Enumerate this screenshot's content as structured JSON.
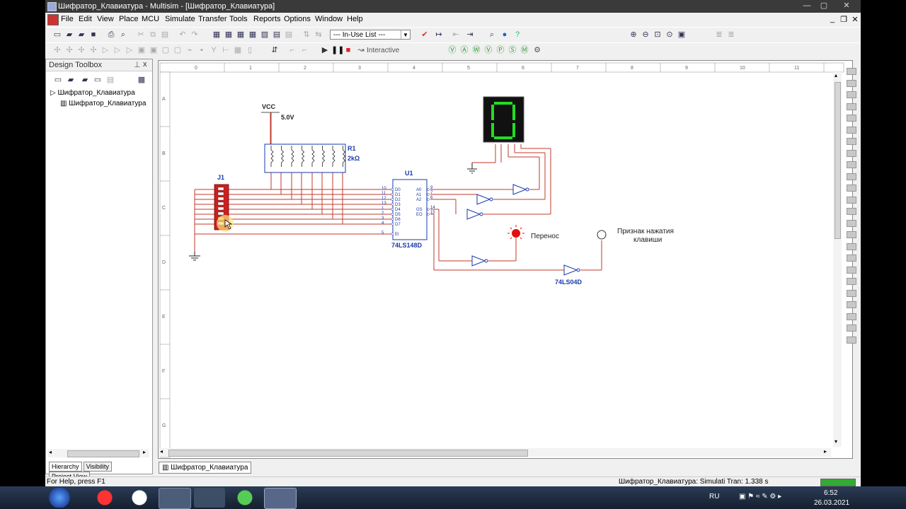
{
  "window": {
    "title": "Шифратор_Клавиатура - Multisim - [Шифратор_Клавиатура]",
    "controls": [
      "—",
      "▢",
      "✕"
    ],
    "mdi_controls": [
      "_",
      "❐",
      "✕"
    ]
  },
  "menu": [
    "File",
    "Edit",
    "View",
    "Place",
    "MCU",
    "Simulate",
    "Transfer",
    "Tools",
    "Reports",
    "Options",
    "Window",
    "Help"
  ],
  "toolbar": {
    "in_use_list": "--- In-Use List ---",
    "interactive": "Interactive"
  },
  "design_toolbox": {
    "title": "Design Toolbox",
    "close": "x",
    "tree": [
      "Шифратор_Клавиатура",
      "Шифратор_Клавиатура"
    ],
    "tabs": [
      "Hierarchy",
      "Visibility",
      "Project View"
    ]
  },
  "canvas": {
    "col_labels": [
      "0",
      "1",
      "2",
      "3",
      "4",
      "5",
      "6",
      "7",
      "8",
      "9",
      "10",
      "11"
    ],
    "row_labels": [
      "A",
      "B",
      "C",
      "D",
      "E",
      "F",
      "G"
    ],
    "vcc_label": "VCC",
    "vcc_value": "5.0V",
    "r1_label": "R1",
    "r1_value": "2kΩ",
    "j1_label": "J1",
    "u1_label": "U1",
    "u1_part": "74LS148D",
    "u1_pins_left": [
      "D0",
      "D1",
      "D2",
      "D3",
      "D4",
      "D5",
      "D6",
      "D7",
      "EI"
    ],
    "u1_pins_right": [
      "A0",
      "A1",
      "A2",
      "GS",
      "EO"
    ],
    "u1_pin_nums_left": [
      "10",
      "11",
      "12",
      "13",
      "1",
      "2",
      "3",
      "4",
      "5"
    ],
    "u1_pin_nums_right": [
      "9",
      "7",
      "6",
      "14",
      "15"
    ],
    "display_digit": "0",
    "led_label": "Перенос",
    "probe_label_line1": "Признак нажатия",
    "probe_label_line2": "клавиши",
    "inverter_part": "74LS04D"
  },
  "document_tab": "Шифратор_Клавиатура",
  "status": {
    "help": "For Help, press F1",
    "sim": "Шифратор_Клавиатура: Simulati Tran: 1.338 s"
  },
  "taskbar": {
    "lang": "RU",
    "time": "6:52",
    "date": "26.03.2021"
  },
  "colors": {
    "wire": "#c0392b",
    "component": "#1a3aa8",
    "seg_on": "#22dd22"
  }
}
